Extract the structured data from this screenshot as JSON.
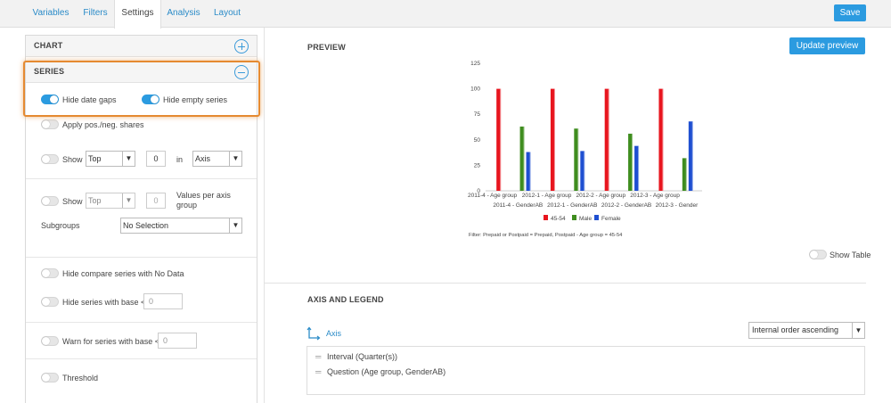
{
  "tabs": [
    {
      "label": "Variables",
      "active": false
    },
    {
      "label": "Filters",
      "active": false
    },
    {
      "label": "Settings",
      "active": true
    },
    {
      "label": "Analysis",
      "active": false
    },
    {
      "label": "Layout",
      "active": false
    }
  ],
  "save_label": "Save",
  "left": {
    "chart_title": "CHART",
    "series_title": "SERIES",
    "hide_date_gaps": "Hide date gaps",
    "hide_empty_series": "Hide empty series",
    "apply_shares": "Apply pos./neg. shares",
    "show1": {
      "label": "Show",
      "select": "Top",
      "number": "0",
      "in_label": "in",
      "axis_select": "Axis"
    },
    "show2": {
      "label": "Show",
      "select": "Top",
      "number": "0",
      "suffix": "Values per axis group"
    },
    "subgroups_label": "Subgroups",
    "subgroups_select": "No Selection",
    "hide_compare": "Hide compare series with No Data",
    "hide_series_base": "Hide series with base <",
    "hide_series_base_value": "0",
    "warn_series_base": "Warn for series with base <",
    "warn_series_base_value": "0",
    "threshold": "Threshold"
  },
  "preview": {
    "title": "PREVIEW",
    "update_button": "Update preview",
    "filter_text": "Filter: Prepaid or Postpaid = Prepaid, Postpaid - Age group = 45-54",
    "show_table": "Show Table"
  },
  "axis_legend": {
    "title": "AXIS AND LEGEND",
    "axis_link": "Axis",
    "order_select": "Internal order ascending",
    "items": [
      "Interval (Quarter(s))",
      "Question (Age group, GenderAB)"
    ]
  },
  "colors": {
    "accent": "#2b9be0",
    "highlight": "#e58a31",
    "red": "#e8151e",
    "green": "#3f8d1f",
    "blue": "#1f4fd1"
  },
  "chart_data": {
    "type": "bar",
    "categories": [
      "2011-4 - Age group",
      "2011-4 - GenderAB",
      "2012-1 - Age group",
      "2012-1 - GenderAB",
      "2012-2 - Age group",
      "2012-2 - GenderAB",
      "2012-3 - Age group",
      "2012-3 - Gender"
    ],
    "x_labels_row1": [
      "2011-4 - Age group",
      "2012-1 - Age group",
      "2012-2 - Age group",
      "2012-3 - Age group"
    ],
    "x_labels_row2": [
      "2011-4 - GenderAB",
      "2012-1 - GenderAB",
      "2012-2 - GenderAB",
      "2012-3 - Gender"
    ],
    "series": [
      {
        "name": "45-54",
        "color": "#e8151e",
        "values": [
          100,
          null,
          100,
          null,
          100,
          null,
          100,
          null
        ]
      },
      {
        "name": "Male",
        "color": "#3f8d1f",
        "values": [
          null,
          63,
          null,
          61,
          null,
          56,
          null,
          32
        ]
      },
      {
        "name": "Female",
        "color": "#1f4fd1",
        "values": [
          null,
          38,
          null,
          39,
          null,
          44,
          null,
          68
        ]
      }
    ],
    "ylim": [
      0,
      125
    ],
    "yticks": [
      0,
      25,
      50,
      75,
      100,
      125
    ],
    "legend_position": "bottom"
  }
}
